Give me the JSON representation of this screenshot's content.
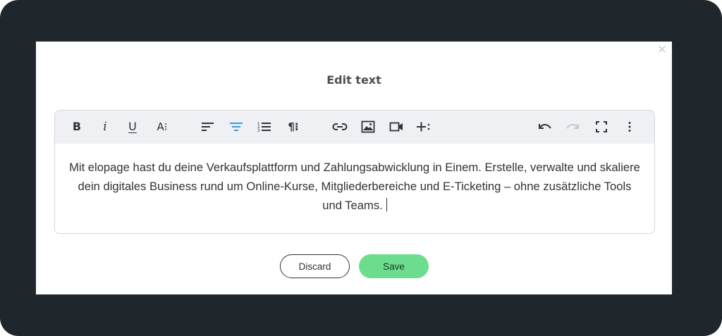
{
  "modal": {
    "title": "Edit text",
    "close_glyph": "×"
  },
  "toolbar": {
    "buttons": [
      {
        "name": "bold",
        "icon": "bold-icon",
        "glyph": "B"
      },
      {
        "name": "italic",
        "icon": "italic-icon",
        "glyph": "i"
      },
      {
        "name": "underline",
        "icon": "underline-icon",
        "glyph": "U"
      },
      {
        "name": "font-size",
        "icon": "font-size-icon",
        "glyph": "A⁝"
      },
      {
        "name": "align-left",
        "icon": "align-left-icon"
      },
      {
        "name": "align-center",
        "icon": "align-center-icon",
        "active": true
      },
      {
        "name": "ordered-list",
        "icon": "ordered-list-icon"
      },
      {
        "name": "paragraph-format",
        "icon": "paragraph-icon",
        "glyph": "¶⁝"
      },
      {
        "name": "insert-link",
        "icon": "link-icon"
      },
      {
        "name": "insert-image",
        "icon": "image-icon"
      },
      {
        "name": "insert-video",
        "icon": "video-icon"
      },
      {
        "name": "insert-more",
        "icon": "plus-more-icon"
      },
      {
        "name": "undo",
        "icon": "undo-icon"
      },
      {
        "name": "redo",
        "icon": "redo-icon",
        "disabled": true
      },
      {
        "name": "fullscreen",
        "icon": "fullscreen-icon"
      },
      {
        "name": "more-options",
        "icon": "more-vertical-icon"
      }
    ],
    "active_color": "#3b9ae1",
    "disabled_color": "#c3c7cc"
  },
  "editor": {
    "text": "Mit elopage hast du deine Verkaufsplattform und Zahlungsabwicklung in Einem. Erstelle, verwalte und skaliere dein digitales Business rund um Online-Kurse, Mitgliederbereiche und E-Ticketing – ohne zusätzliche Tools und Teams."
  },
  "actions": {
    "discard_label": "Discard",
    "save_label": "Save",
    "save_color": "#6cdc8e"
  }
}
